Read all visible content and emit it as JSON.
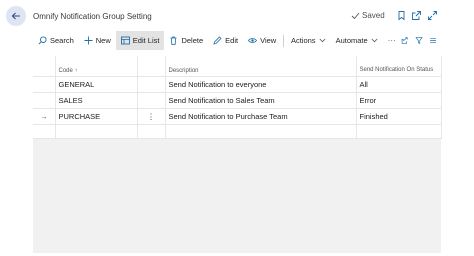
{
  "page": {
    "title": "Omnify Notification Group Setting",
    "saved_label": "Saved"
  },
  "toolbar": {
    "search": "Search",
    "new": "New",
    "edit_list": "Edit List",
    "delete": "Delete",
    "edit": "Edit",
    "view": "View",
    "actions": "Actions",
    "automate": "Automate",
    "more": "···"
  },
  "table": {
    "columns": {
      "code": "Code ↑",
      "description": "Description",
      "status": "Send Notification On Status"
    },
    "rows": [
      {
        "code": "GENERAL",
        "description": "Send Notification to everyone",
        "status": "All"
      },
      {
        "code": "SALES",
        "description": "Send Notification to Sales Team",
        "status": "Error"
      },
      {
        "code": "PURCHASE",
        "description": "Send  Notification to Purchase Team",
        "status": "Finished"
      }
    ],
    "selected_row_marker": "→",
    "row_menu": "⋮"
  },
  "colors": {
    "accent": "#1f6fa8",
    "selected_cell": "#bfe3ec",
    "back_button_bg": "#dfe4f2"
  }
}
